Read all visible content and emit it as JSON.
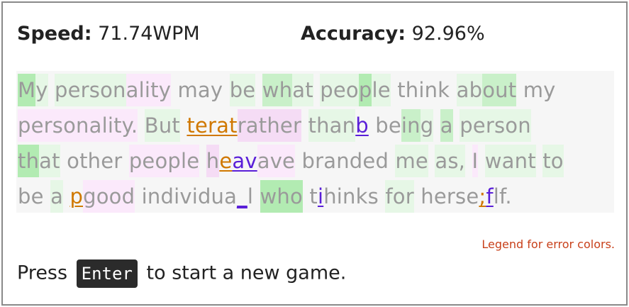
{
  "stats": {
    "speed_label": "Speed:",
    "speed_value": "71.74WPM",
    "accuracy_label": "Accuracy:",
    "accuracy_value": "92.96%"
  },
  "passage": {
    "lines": [
      [
        {
          "t": "M",
          "s": "g3"
        },
        {
          "t": "y",
          "s": "g1"
        },
        {
          "t": " ",
          "s": ""
        },
        {
          "t": "person",
          "s": "g1"
        },
        {
          "t": "ality",
          "s": "p1"
        },
        {
          "t": " ",
          "s": ""
        },
        {
          "t": "may",
          "s": ""
        },
        {
          "t": " ",
          "s": ""
        },
        {
          "t": "be",
          "s": "g1"
        },
        {
          "t": " ",
          "s": ""
        },
        {
          "t": "wh",
          "s": "g2"
        },
        {
          "t": "at",
          "s": "g1"
        },
        {
          "t": " ",
          "s": ""
        },
        {
          "t": "peo",
          "s": "g1"
        },
        {
          "t": "p",
          "s": "g3"
        },
        {
          "t": "le",
          "s": "g1"
        },
        {
          "t": " ",
          "s": ""
        },
        {
          "t": "think",
          "s": ""
        },
        {
          "t": " ",
          "s": ""
        },
        {
          "t": "ab",
          "s": "g1"
        },
        {
          "t": "out",
          "s": "g2"
        },
        {
          "t": " ",
          "s": ""
        },
        {
          "t": "my",
          "s": ""
        }
      ],
      [
        {
          "t": "personality.",
          "s": "p1"
        },
        {
          "t": " ",
          "s": ""
        },
        {
          "t": "But",
          "s": "g1"
        },
        {
          "t": " ",
          "s": ""
        },
        {
          "t": "terat",
          "s": "err-orange"
        },
        {
          "t": "rather",
          "s": "p2"
        },
        {
          "t": " ",
          "s": ""
        },
        {
          "t": "than",
          "s": "g1"
        },
        {
          "t": "b",
          "s": "err-purple"
        },
        {
          "t": " ",
          "s": ""
        },
        {
          "t": "be",
          "s": ""
        },
        {
          "t": "in",
          "s": "g2"
        },
        {
          "t": "g",
          "s": "g1"
        },
        {
          "t": " ",
          "s": ""
        },
        {
          "t": "a",
          "s": "g2"
        },
        {
          "t": " ",
          "s": ""
        },
        {
          "t": "person",
          "s": "g1"
        }
      ],
      [
        {
          "t": "th",
          "s": "g3"
        },
        {
          "t": "at",
          "s": "g1"
        },
        {
          "t": " ",
          "s": ""
        },
        {
          "t": "other",
          "s": ""
        },
        {
          "t": " ",
          "s": ""
        },
        {
          "t": "people",
          "s": "p1"
        },
        {
          "t": " ",
          "s": ""
        },
        {
          "t": "h",
          "s": "p2"
        },
        {
          "t": "e",
          "s": "err-orange"
        },
        {
          "t": "av",
          "s": "err-purple"
        },
        {
          "t": "ave",
          "s": "p1"
        },
        {
          "t": " ",
          "s": ""
        },
        {
          "t": "branded",
          "s": ""
        },
        {
          "t": " ",
          "s": ""
        },
        {
          "t": "me",
          "s": "g1"
        },
        {
          "t": " ",
          "s": ""
        },
        {
          "t": "as,",
          "s": "g1"
        },
        {
          "t": " ",
          "s": ""
        },
        {
          "t": "I",
          "s": "p1"
        },
        {
          "t": " ",
          "s": ""
        },
        {
          "t": "want",
          "s": "g1"
        },
        {
          "t": " ",
          "s": ""
        },
        {
          "t": "to",
          "s": "g1"
        }
      ],
      [
        {
          "t": "be",
          "s": ""
        },
        {
          "t": " ",
          "s": ""
        },
        {
          "t": "a",
          "s": "g1"
        },
        {
          "t": " ",
          "s": ""
        },
        {
          "t": "p",
          "s": "err-orange"
        },
        {
          "t": "good",
          "s": "p1"
        },
        {
          "t": " ",
          "s": ""
        },
        {
          "t": "individua",
          "s": ""
        },
        {
          "t": "_",
          "s": "err-purple"
        },
        {
          "t": "l",
          "s": ""
        },
        {
          "t": " ",
          "s": ""
        },
        {
          "t": "who",
          "s": "g3"
        },
        {
          "t": " ",
          "s": ""
        },
        {
          "t": "t",
          "s": ""
        },
        {
          "t": "i",
          "s": "err-purple"
        },
        {
          "t": "hinks",
          "s": ""
        },
        {
          "t": " ",
          "s": ""
        },
        {
          "t": "for",
          "s": "g1"
        },
        {
          "t": " ",
          "s": ""
        },
        {
          "t": "herse",
          "s": ""
        },
        {
          "t": ";",
          "s": "err-orange"
        },
        {
          "t": "f",
          "s": "err-purple"
        },
        {
          "t": "lf.",
          "s": ""
        }
      ]
    ]
  },
  "legend": {
    "label": "Legend for error colors."
  },
  "footer": {
    "prefix": "Press",
    "key": "Enter",
    "suffix": "to start a new game."
  },
  "colors": {
    "text_dim": "#9a9a9a",
    "error_orange": "#d07800",
    "error_purple": "#5a1fd8",
    "legend": "#c8401a",
    "key_bg": "#2b2b2b"
  }
}
